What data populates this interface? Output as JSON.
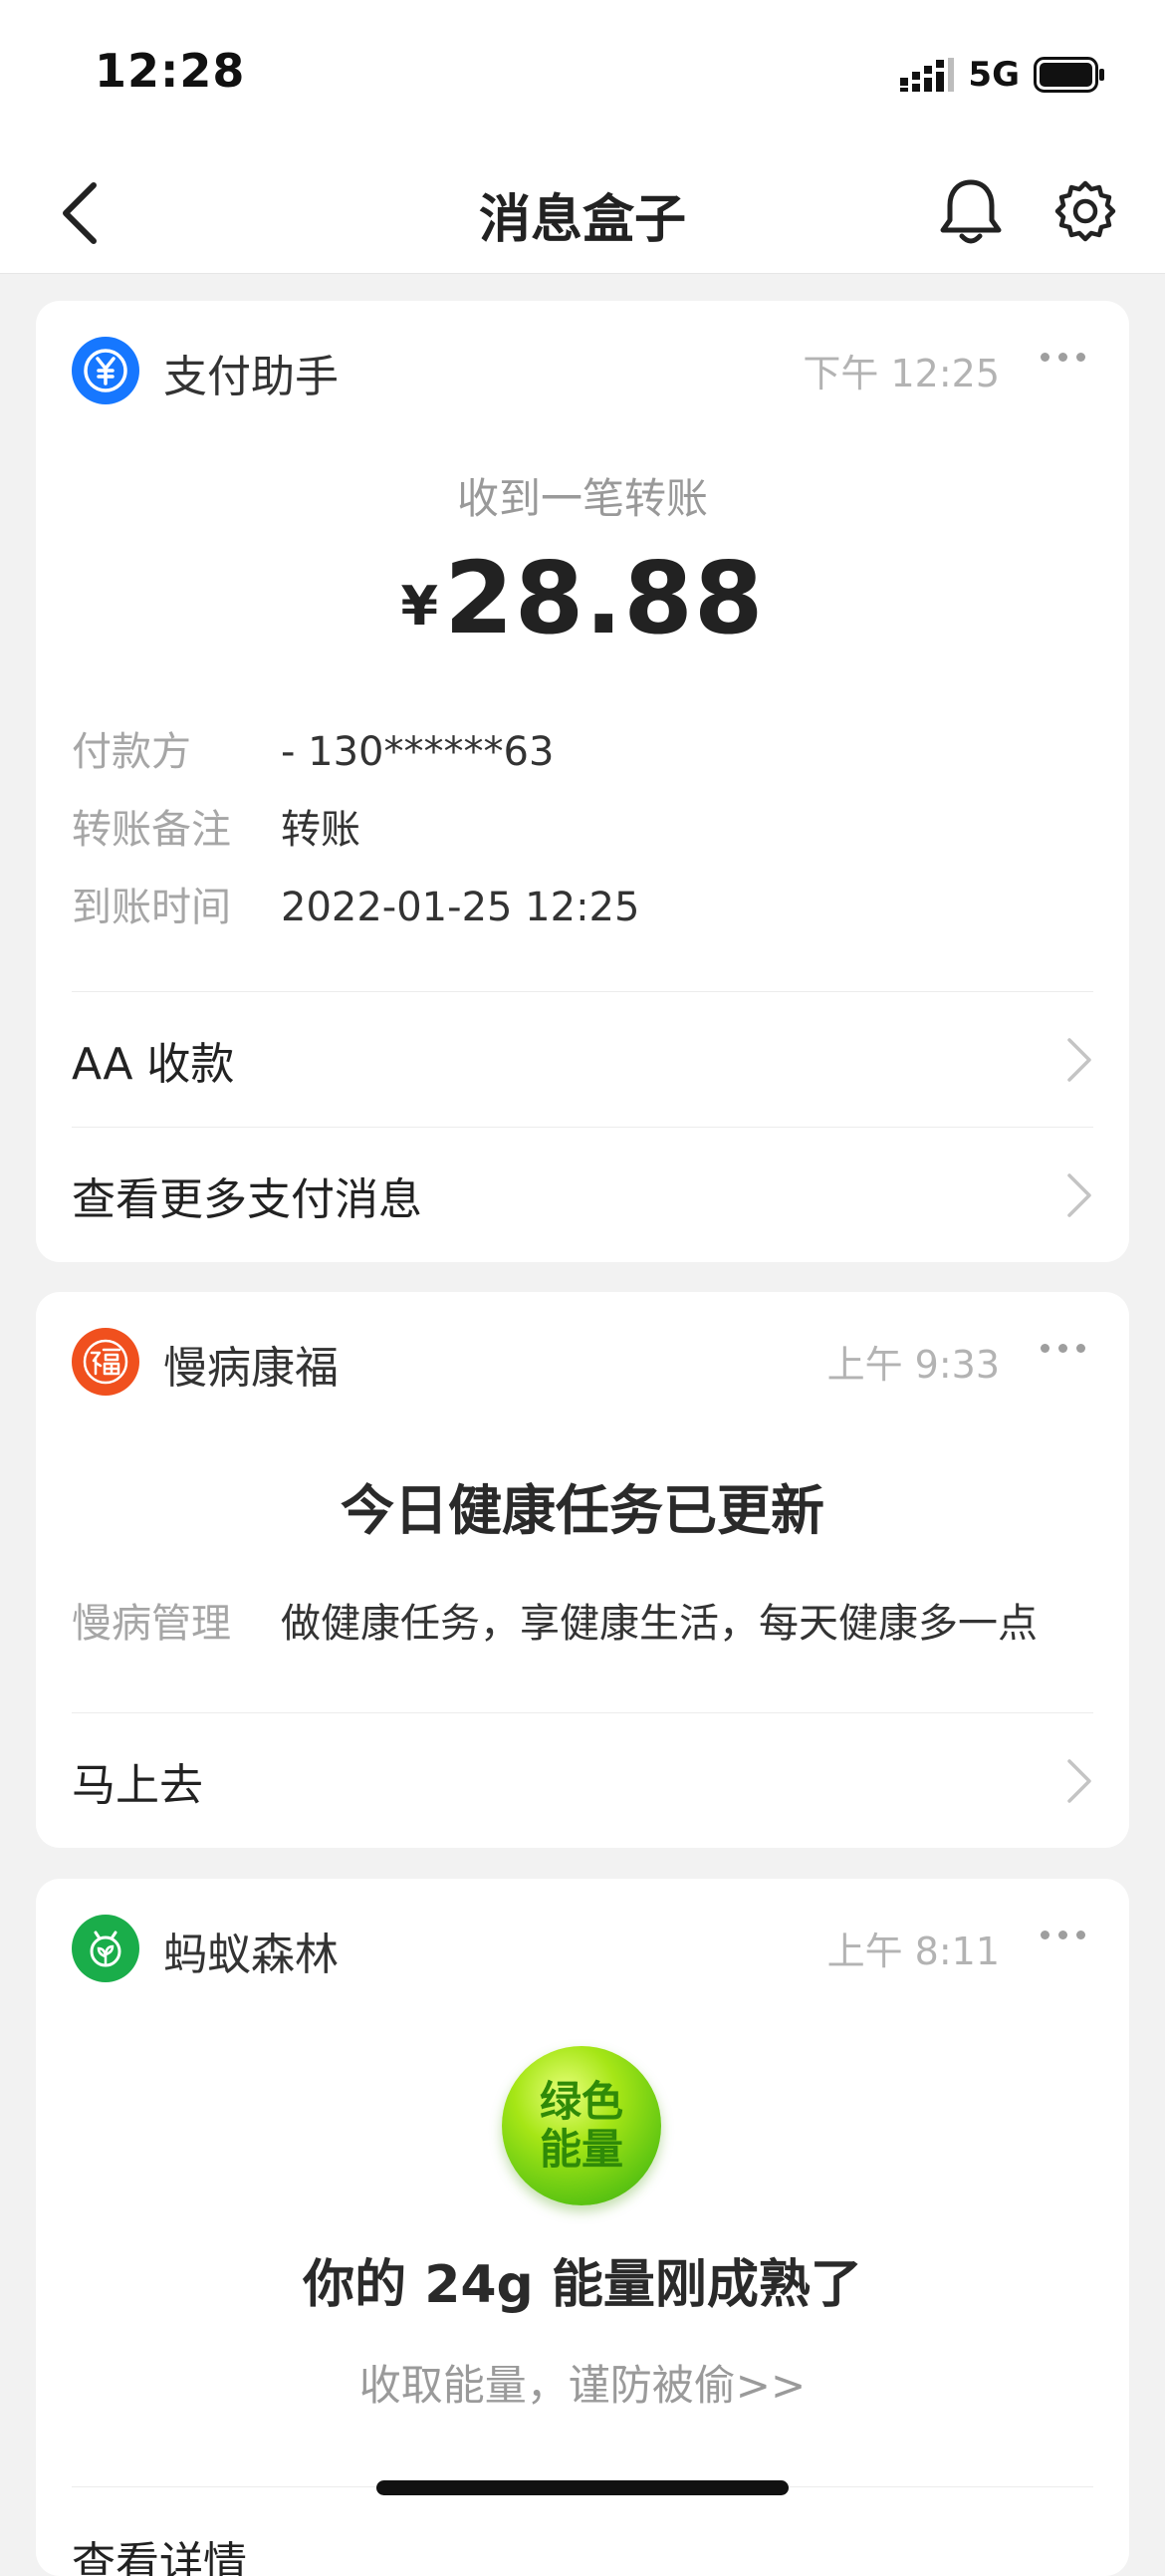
{
  "status_bar": {
    "time": "12:28",
    "network": "5G"
  },
  "nav": {
    "title": "消息盒子"
  },
  "cards": [
    {
      "app_name": "支付助手",
      "time": "下午 12:25",
      "subtitle": "收到一笔转账",
      "currency_symbol": "¥",
      "amount": "28.88",
      "fields": [
        {
          "key": "付款方",
          "value": "- 130******63"
        },
        {
          "key": "转账备注",
          "value": "转账"
        },
        {
          "key": "到账时间",
          "value": "2022-01-25 12:25"
        }
      ],
      "links": [
        "AA 收款",
        "查看更多支付消息"
      ],
      "icon_color": "#1677ff"
    },
    {
      "app_name": "慢病康福",
      "time": "上午 9:33",
      "title": "今日健康任务已更新",
      "field": {
        "key": "慢病管理",
        "value": "做健康任务，享健康生活，每天健康多一点"
      },
      "links": [
        "马上去"
      ],
      "icon_color": "#f0501e"
    },
    {
      "app_name": "蚂蚁森林",
      "time": "上午 8:11",
      "badge_text": "绿色能量",
      "title": "你的 24g 能量刚成熟了",
      "subtitle": "收取能量，谨防被偷>>",
      "links": [
        "查看详情"
      ],
      "icon_color": "#1aad4a"
    }
  ]
}
